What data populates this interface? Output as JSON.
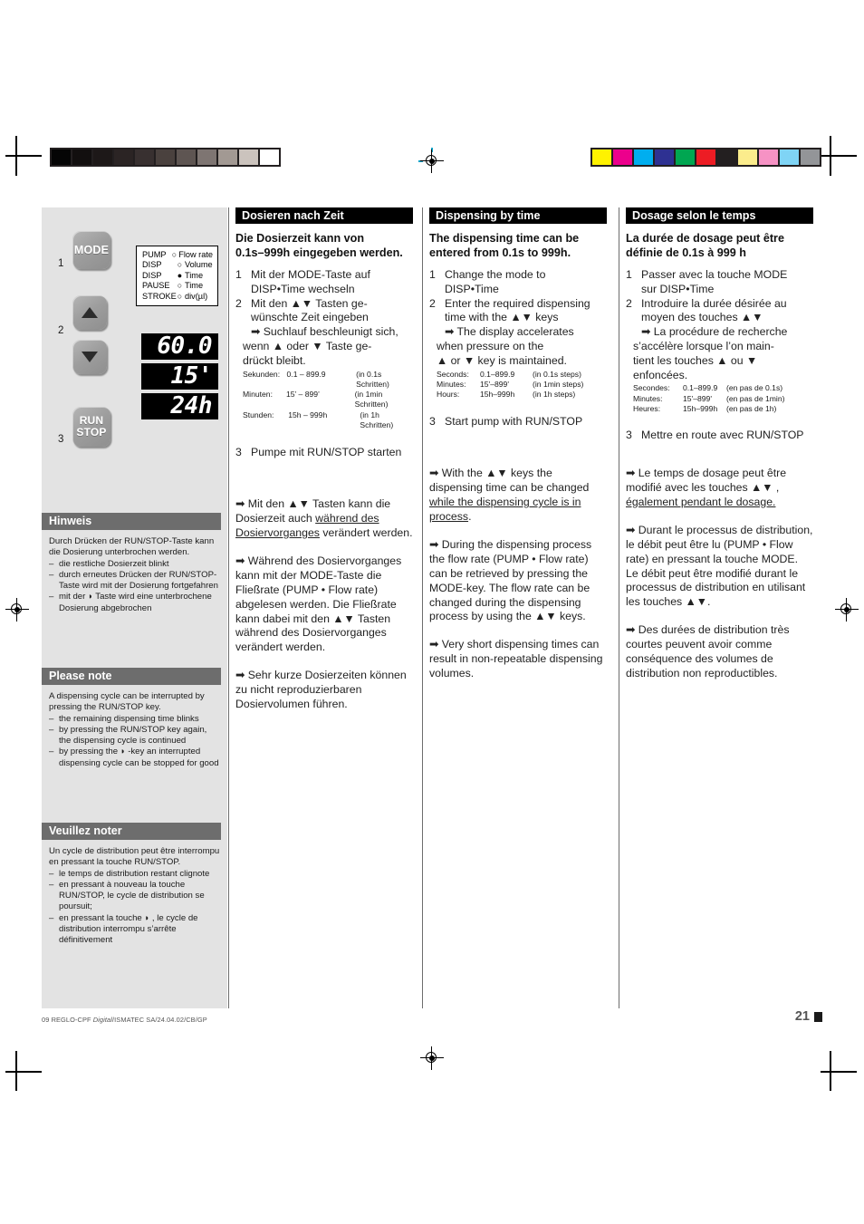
{
  "document": {
    "footer_code_prefix": "09 REGLO-CPF ",
    "footer_code_italic": "Digital",
    "footer_code_suffix": "/ISMATEC SA/24.04.02/CB/GP",
    "page_number": "21"
  },
  "colorbars": {
    "gray_steps": [
      "#050505",
      "#120f0f",
      "#1d1818",
      "#2b2424",
      "#383030",
      "#4a413e",
      "#5e5552",
      "#7e7572",
      "#a29993",
      "#cbc3bd",
      "#ffffff"
    ],
    "process_colors": [
      "#fff200",
      "#ec008c",
      "#00aeef",
      "#2e3192",
      "#00a651",
      "#ed1c24",
      "#231f20",
      "#fbec8c",
      "#f692c4",
      "#7fd4f5",
      "#939598"
    ]
  },
  "panel": {
    "keys": [
      {
        "name": "MODE",
        "label": "MODE",
        "step": "1"
      },
      {
        "name": "UP",
        "label": "",
        "step": "2"
      },
      {
        "name": "DOWN",
        "label": "",
        "step": ""
      },
      {
        "name": "RUN/STOP",
        "label_line1": "RUN",
        "label_line2": "STOP",
        "step": "3"
      }
    ],
    "step_numbers": {
      "one": "1",
      "two": "2",
      "three": "3"
    },
    "mode_legend": [
      {
        "mode": "PUMP",
        "led": "off",
        "param": "Flow rate"
      },
      {
        "mode": "DISP",
        "led": "off",
        "param": "Volume"
      },
      {
        "mode": "DISP",
        "led": "on",
        "param": "Time"
      },
      {
        "mode": "PAUSE",
        "led": "off",
        "param": "Time"
      },
      {
        "mode": "STROKE",
        "led": "off",
        "param": "div(µl)"
      }
    ],
    "displays": [
      "60.0",
      "15'",
      "24h"
    ]
  },
  "notes": [
    {
      "id": "hinweis",
      "title": "Hinweis",
      "intro": "Durch Drücken der RUN/STOP-Taste kann die Dosierung unterbrochen werden.",
      "bullets": [
        "die restliche Dosierzeit blinkt",
        "durch erneutes Drücken der RUN/STOP-Taste wird mit der Dosierung fortgefahren",
        "mit der ◗ Taste wird eine unterbrochene Dosierung abgebrochen"
      ]
    },
    {
      "id": "please-note",
      "title": "Please note",
      "intro": "A dispensing cycle can be interrupted by pressing the RUN/STOP key.",
      "bullets": [
        "the remaining dispensing time blinks",
        "by pressing the RUN/STOP key again, the dispensing cycle is continued",
        "by pressing the ◗ -key an interrupted dispensing cycle can be stopped for good"
      ]
    },
    {
      "id": "veuillez-noter",
      "title": "Veuillez noter",
      "intro": "Un cycle de distribution peut être interrompu en pressant la touche RUN/STOP.",
      "bullets": [
        "le temps de distribution restant clignote",
        "en pressant à nouveau la touche RUN/STOP, le cycle de distribution se poursuit;",
        "en pressant la touche ◗ , le cycle de distribution interrompu s’arrête définitivement"
      ]
    }
  ],
  "columns": {
    "de": {
      "heading": "Dosieren nach Zeit",
      "lead_l1": "Die Dosierzeit kann von",
      "lead_l2": "0.1s–999h eingegeben werden.",
      "step1_num": "1",
      "step1_l1": "Mit der MODE-Taste auf",
      "step1_l2": "DISP•Time wechseln",
      "step2_num": "2",
      "step2_l1": "Mit den ▲▼ Tasten ge-",
      "step2_l2": "wünschte Zeit eingeben",
      "step2_sub1": "➡ Suchlauf beschleunigt sich,",
      "step2_sub2": "wenn ▲ oder ▼ Taste ge-",
      "step2_sub3": "drückt bleibt.",
      "ranges": [
        {
          "label": "Sekunden:",
          "value": "0.1 – 899.9",
          "steps": "(in 0.1s Schritten)"
        },
        {
          "label": "Minuten:",
          "value": "15’ – 899’",
          "steps": "(in 1min Schritten)"
        },
        {
          "label": "Stunden:",
          "value": "15h – 999h",
          "steps": "(in 1h Schritten)"
        }
      ],
      "step3_num": "3",
      "step3_text": "Pumpe mit RUN/STOP starten",
      "p1_a": "➡ Mit den ▲▼ Tasten kann die Dosierzeit auch ",
      "p1_u": "während des Dosiervorganges",
      "p1_b": " verändert werden.",
      "p2": "➡ Während des Dosiervorganges kann mit der MODE-Taste die Fließrate (PUMP • Flow rate) abgelesen werden. Die Fließrate kann dabei mit den ▲▼ Tasten während des Dosiervorganges verändert werden.",
      "p3": "➡ Sehr kurze Dosierzeiten können zu nicht reproduzierbaren Dosiervolumen führen."
    },
    "en": {
      "heading": "Dispensing by time",
      "lead_l1": "The dispensing time can be",
      "lead_l2": "entered from 0.1s to 999h.",
      "step1_num": "1",
      "step1_l1": "Change the mode to",
      "step1_l2": "DISP•Time",
      "step2_num": "2",
      "step2_l1": "Enter the required dispensing",
      "step2_l2": "time with the ▲▼  keys",
      "step2_sub1": "➡ The display accelerates",
      "step2_sub2": "when pressure on the",
      "step2_sub3": "▲ or ▼ key is maintained.",
      "ranges": [
        {
          "label": "Seconds:",
          "value": "0.1–899.9",
          "steps": "(in 0.1s steps)"
        },
        {
          "label": "Minutes:",
          "value": "15'–899'",
          "steps": "(in 1min steps)"
        },
        {
          "label": "Hours:",
          "value": "15h–999h",
          "steps": "(in 1h steps)"
        }
      ],
      "step3_num": "3",
      "step3_text": "Start pump with RUN/STOP",
      "p1_a": "➡ With the ▲▼ keys the dispensing time can be changed ",
      "p1_u": "while the dispensing cycle is in process",
      "p1_b": ".",
      "p2": "➡  During the dispensing process the flow rate (PUMP • Flow rate) can be retrieved by pressing the MODE-key. The flow rate can be changed during the dispensing process by using the ▲▼ keys.",
      "p3": "➡  Very short dispensing times can result in non-repeatable dispensing volumes."
    },
    "fr": {
      "heading": "Dosage selon le temps",
      "lead_l1": "La durée de dosage peut être",
      "lead_l2": "définie de 0.1s à 999 h",
      "step1_num": "1",
      "step1_l1": "Passer avec la touche MODE",
      "step1_l2": "sur DISP•Time",
      "step2_num": "2",
      "step2_l1": "Introduire la durée désirée au",
      "step2_l2": "moyen des touches ▲▼",
      "step2_sub1": "➡ La procédure de recherche",
      "step2_sub2": "s’accélère lorsque l’on main-",
      "step2_sub3": "tient les touches ▲ ou ▼",
      "step2_sub4": "enfoncées.",
      "ranges": [
        {
          "label": "Secondes:",
          "value": "0.1–899.9",
          "steps": "(en pas de 0.1s)"
        },
        {
          "label": "Minutes:",
          "value": "15'–899'",
          "steps": "(en pas de 1min)"
        },
        {
          "label": "Heures:",
          "value": "15h–999h",
          "steps": "(en pas de 1h)"
        }
      ],
      "step3_num": "3",
      "step3_text": "Mettre en route avec RUN/STOP",
      "p1_a": "➡ Le temps de dosage peut être modifié avec les touches ▲▼ , ",
      "p1_u": "également pendant le dosage.",
      "p1_b": "",
      "p2": "➡ Durant le processus de distribution, le débit peut être lu (PUMP • Flow rate) en pressant la touche MODE. Le débit peut être modifié durant le processus de distribution en utilisant les touches ▲▼.",
      "p3": "➡ Des durées de distribution très courtes peuvent avoir comme conséquence des volumes de distribution non reproductibles."
    }
  }
}
